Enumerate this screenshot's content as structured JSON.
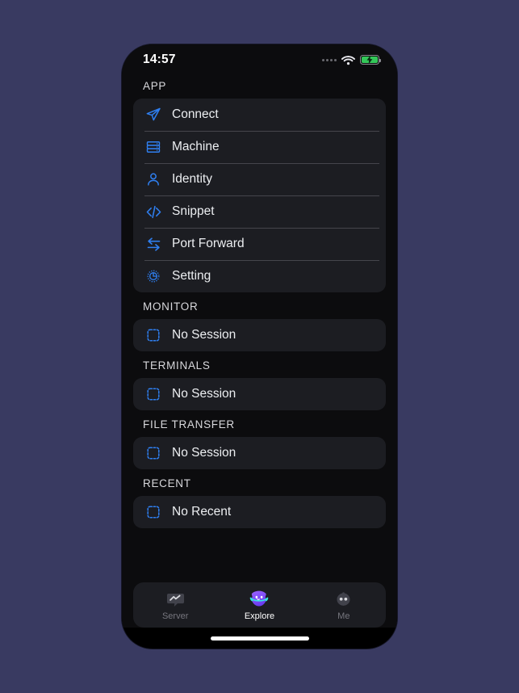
{
  "theme": {
    "page_background": "#393a61",
    "screen_background": "#0c0c0e",
    "card_background": "#1c1d22",
    "accent_blue": "#2f7ff0",
    "battery_green": "#34c759",
    "explore_purple": "#7b4dff",
    "explore_cyan": "#35e6e0",
    "text_primary": "#eceef1",
    "text_secondary": "#76767e"
  },
  "status_bar": {
    "time": "14:57",
    "signal_icon": "signal-dots-icon",
    "wifi_icon": "wifi-icon",
    "battery_icon": "battery-charging-icon"
  },
  "sections": [
    {
      "header": "APP",
      "rows": [
        {
          "label": "Connect",
          "icon": "paper-plane-icon"
        },
        {
          "label": "Machine",
          "icon": "server-stack-icon"
        },
        {
          "label": "Identity",
          "icon": "person-icon"
        },
        {
          "label": "Snippet",
          "icon": "code-brackets-icon"
        },
        {
          "label": "Port Forward",
          "icon": "arrows-exchange-icon"
        },
        {
          "label": "Setting",
          "icon": "gear-icon"
        }
      ]
    },
    {
      "header": "MONITOR",
      "rows": [
        {
          "label": "No Session",
          "icon": "dashed-square-icon"
        }
      ]
    },
    {
      "header": "TERMINALS",
      "rows": [
        {
          "label": "No Session",
          "icon": "dashed-square-icon"
        }
      ]
    },
    {
      "header": "FILE TRANSFER",
      "rows": [
        {
          "label": "No Session",
          "icon": "dashed-square-icon"
        }
      ]
    },
    {
      "header": "RECENT",
      "rows": [
        {
          "label": "No Recent",
          "icon": "dashed-square-icon"
        }
      ]
    }
  ],
  "tab_bar": {
    "tabs": [
      {
        "label": "Server",
        "icon": "server-chat-icon",
        "active": false
      },
      {
        "label": "Explore",
        "icon": "explore-blob-icon",
        "active": true
      },
      {
        "label": "Me",
        "icon": "avatar-icon",
        "active": false
      }
    ]
  },
  "home_indicator": {
    "name": "home-indicator"
  }
}
